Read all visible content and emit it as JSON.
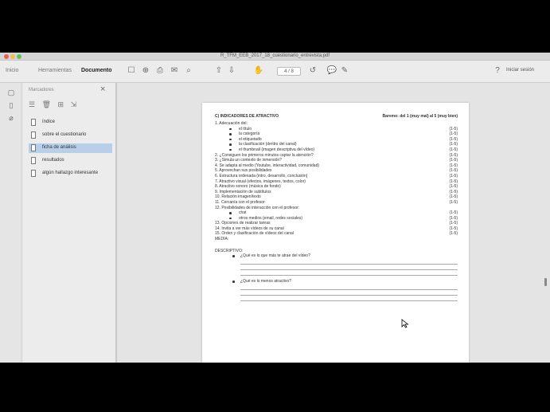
{
  "window": {
    "title": "R_TFM_EEB_2017_18_cuestionario_entrevista.pdf"
  },
  "toolbar": {
    "tabs": [
      "Inicio",
      "Herramientas",
      "Documento"
    ],
    "page_current": "4",
    "page_total": "/ 8",
    "signin": "Iniciar sesión"
  },
  "sidebar": {
    "title": "Marcadores",
    "bookmarks": [
      {
        "label": "índice",
        "selected": false
      },
      {
        "label": "sobre el cuestionario",
        "selected": false
      },
      {
        "label": "ficha de análisis",
        "selected": true
      },
      {
        "label": "resultados",
        "selected": false
      },
      {
        "label": "algún hallazgo interesante",
        "selected": false
      }
    ]
  },
  "document": {
    "header_left": "C) INDICADORES DE ATRACTIVO",
    "header_right": "Baremo: del 1 (muy mal) al 5 (muy bien)",
    "rows": [
      {
        "text": "1. Adecuación del:",
        "score": "",
        "bullet": false
      },
      {
        "text": "el título",
        "score": "(1-5)",
        "bullet": true
      },
      {
        "text": "la categoría",
        "score": "(1-5)",
        "bullet": true
      },
      {
        "text": "el etiquetado",
        "score": "(1-5)",
        "bullet": true
      },
      {
        "text": "la clasificación (dentro del canal)",
        "score": "(1-5)",
        "bullet": true
      },
      {
        "text": "el thumbnail (imagen descriptiva del vídeo)",
        "score": "(1-5)",
        "bullet": true
      },
      {
        "text": "2. ¿Consiguen los primeros minutos captar la atención?",
        "score": "(1-5)",
        "bullet": false
      },
      {
        "text": "3. ¿Simula un contexto de inmersión?",
        "score": "(1-5)",
        "bullet": false
      },
      {
        "text": "4. Se adapta al medio (Youtube, interactividad, comunidad)",
        "score": "(1-5)",
        "bullet": false
      },
      {
        "text": "5. Aprovechan sus posibilidades",
        "score": "(1-5)",
        "bullet": false
      },
      {
        "text": "6. Estructura ordenada (intro, desarrollo, conclusión)",
        "score": "(1-5)",
        "bullet": false
      },
      {
        "text": "7. Atractivo visual (efectos, imágenes, textos, color)",
        "score": "(1-5)",
        "bullet": false
      },
      {
        "text": "8. Atractivo sonoro (música de fondo)",
        "score": "(1-5)",
        "bullet": false
      },
      {
        "text": "9. Implementación de subtítulos",
        "score": "(1-5)",
        "bullet": false
      },
      {
        "text": "10. Relación imagen/texto",
        "score": "(1-5)",
        "bullet": false
      },
      {
        "text": "11. Cercanía con el profesor",
        "score": "(1-5)",
        "bullet": false
      },
      {
        "text": "12. Posibilidades de interacción con el profesor:",
        "score": "",
        "bullet": false
      },
      {
        "text": "chat",
        "score": "(1-5)",
        "bullet": true
      },
      {
        "text": "otros medios (email, redes sociales)",
        "score": "(1-5)",
        "bullet": true
      },
      {
        "text": "13. Opciones de realizar tareas",
        "score": "(1-5)",
        "bullet": false
      },
      {
        "text": "14. Invita a ver más vídeos de su canal",
        "score": "(1-5)",
        "bullet": false
      },
      {
        "text": "15. Orden y clasificación de vídeos del canal",
        "score": "(1-5)",
        "bullet": false
      },
      {
        "text": "MEDIA:",
        "score": "",
        "bullet": false
      }
    ],
    "descriptive_label": "DESCRIPTIVO:",
    "questions": [
      "¿Qué es lo que más te atrae del vídeo?",
      "¿Qué es lo menos atractivo?"
    ]
  },
  "icons": [
    "bookmark-icon",
    "pages-icon",
    "attachment-icon",
    "print-icon",
    "zoom-icon",
    "close-icon"
  ]
}
